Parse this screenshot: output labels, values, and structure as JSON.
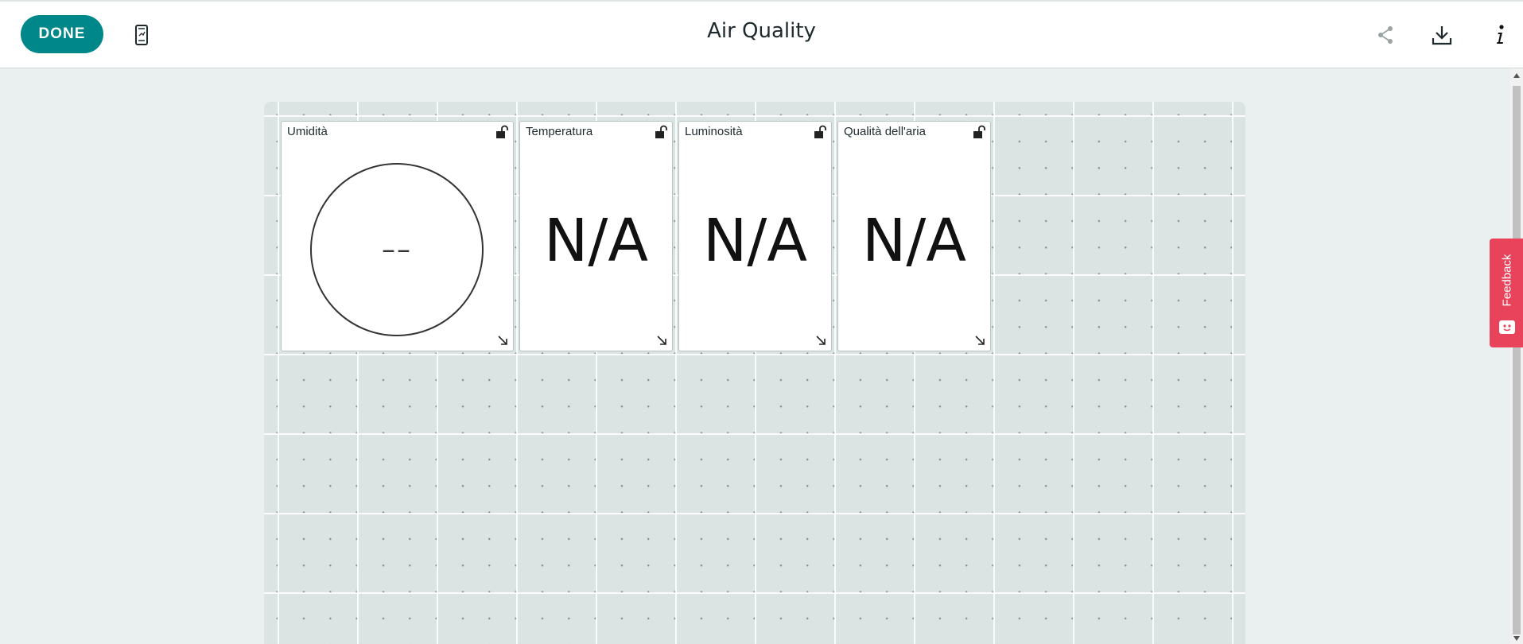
{
  "header": {
    "done_label": "DONE",
    "title": "Air Quality",
    "icons": [
      "mobile-icon",
      "share-icon",
      "download-icon",
      "info-icon"
    ]
  },
  "widgets": [
    {
      "title": "Umidità",
      "type": "gauge",
      "value": "––"
    },
    {
      "title": "Temperatura",
      "type": "value",
      "value": "N/A"
    },
    {
      "title": "Luminosità",
      "type": "value",
      "value": "N/A"
    },
    {
      "title": "Qualità dell'aria",
      "type": "value",
      "value": "N/A"
    }
  ],
  "feedback": {
    "label": "Feedback",
    "color": "#e8435b"
  },
  "colors": {
    "accent": "#00878a",
    "canvas": "#dbe3e3",
    "background": "#eaf0f0"
  }
}
